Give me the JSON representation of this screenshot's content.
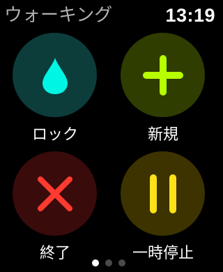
{
  "header": {
    "app_title": "ウォーキング",
    "time": "13:19"
  },
  "colors": {
    "title": "#b0b0b0",
    "lock_bg": "#0c3d3b",
    "lock_icon": "#00f5e4",
    "new_bg": "#2f3d00",
    "new_icon": "#b7ff00",
    "end_bg": "#3a0b0b",
    "end_icon": "#ff3b30",
    "pause_bg": "#3d3300",
    "pause_icon": "#ffe11a"
  },
  "actions": [
    {
      "id": "lock",
      "label": "ロック",
      "icon": "water-drop-icon"
    },
    {
      "id": "new",
      "label": "新規",
      "icon": "plus-icon"
    },
    {
      "id": "end",
      "label": "終了",
      "icon": "x-icon"
    },
    {
      "id": "pause",
      "label": "一時停止",
      "icon": "pause-icon"
    }
  ],
  "pager": {
    "pages": 3,
    "active_index": 0
  }
}
